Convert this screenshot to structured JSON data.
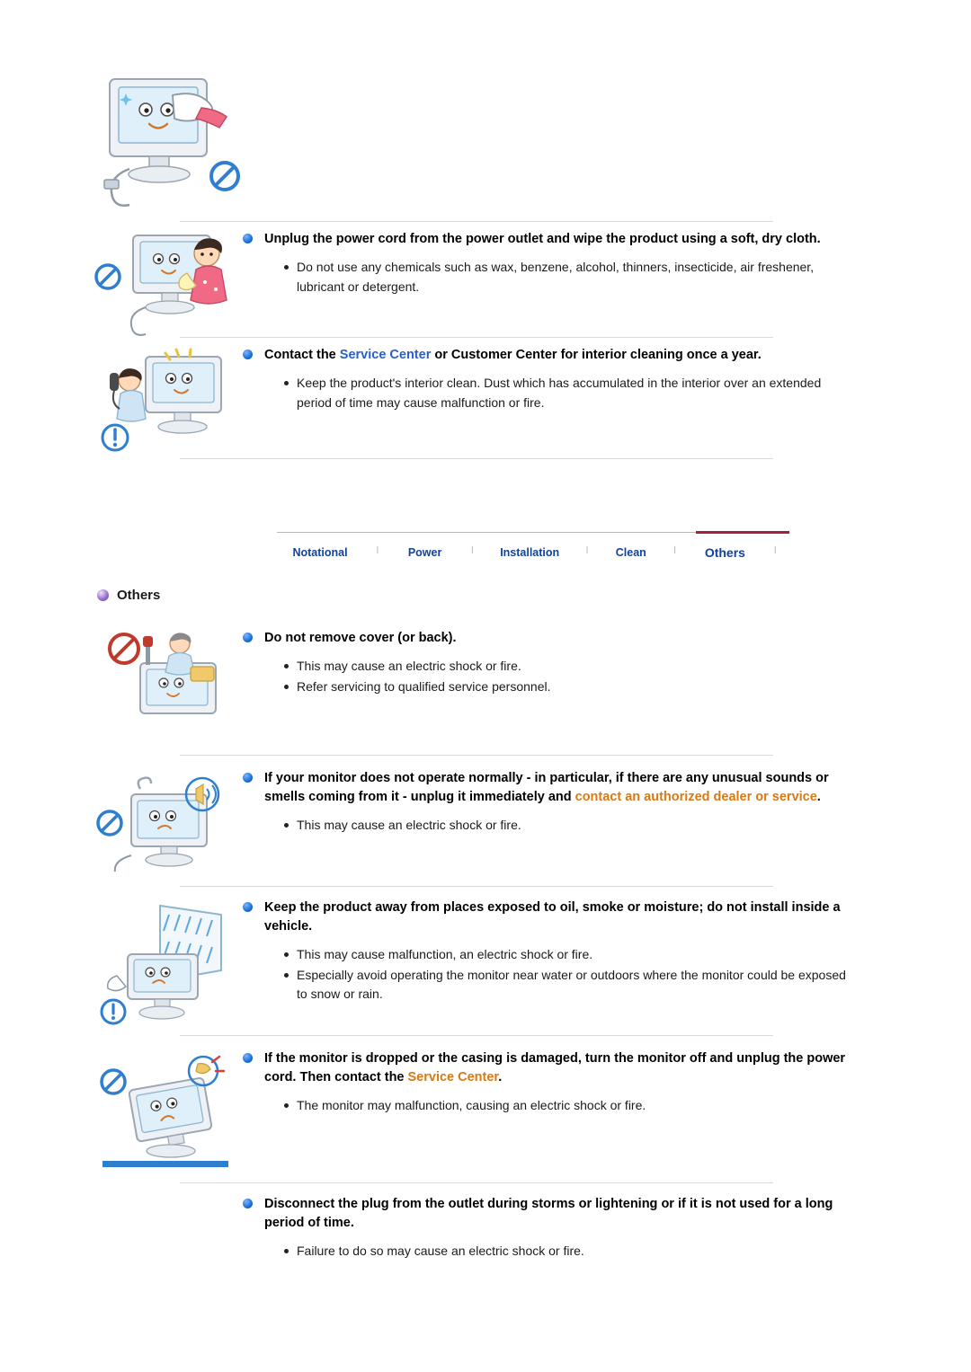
{
  "sections": {
    "top_illustration": {
      "name": "monitor-cleaning-cloth-illustration"
    },
    "unplug": {
      "heading_parts": [
        {
          "text": "Unplug the power cord from the power outlet and wipe the product using a soft, dry cloth.",
          "style": "normal"
        }
      ],
      "items": [
        "Do not use any chemicals such as wax, benzene, alcohol, thinners, insecticide, air freshener, lubricant or detergent."
      ]
    },
    "contact_center": {
      "heading_parts": [
        {
          "text": "Contact the ",
          "style": "normal"
        },
        {
          "text": "Service Center",
          "style": "blue"
        },
        {
          "text": " or Customer Center for interior cleaning once a year.",
          "style": "normal"
        }
      ],
      "items": [
        "Keep the product's interior clean. Dust which has accumulated in the interior over an extended period of time may cause malfunction or fire."
      ]
    }
  },
  "tabbar": {
    "tabs": [
      {
        "label": "Notational",
        "active": false
      },
      {
        "label": "Power",
        "active": false
      },
      {
        "label": "Installation",
        "active": false
      },
      {
        "label": "Clean",
        "active": false
      },
      {
        "label": "Others",
        "active": true
      }
    ],
    "separator": "l"
  },
  "others": {
    "title": "Others",
    "blocks": [
      {
        "id": "do-not-remove-cover",
        "heading_parts": [
          {
            "text": "Do not remove cover (or back).",
            "style": "normal"
          }
        ],
        "items": [
          "This may cause an electric shock or fire.",
          "Refer servicing to qualified service personnel."
        ]
      },
      {
        "id": "abnormal-operation",
        "heading_parts": [
          {
            "text": "If your monitor does not operate normally - in particular, if there are any unusual sounds or smells coming from it - unplug it immediately and ",
            "style": "normal"
          },
          {
            "text": "contact an authorized dealer or service",
            "style": "orange"
          },
          {
            "text": ".",
            "style": "normal"
          }
        ],
        "items": [
          "This may cause an electric shock or fire."
        ]
      },
      {
        "id": "keep-away-oil-smoke-moisture",
        "heading_parts": [
          {
            "text": "Keep the product away from places exposed to oil, smoke or moisture; do not install inside a vehicle.",
            "style": "normal"
          }
        ],
        "items": [
          "This may cause malfunction, an electric shock or fire.",
          "Especially avoid operating the monitor near water or outdoors where the monitor could be exposed to snow or rain."
        ]
      },
      {
        "id": "dropped-or-damaged",
        "heading_parts": [
          {
            "text": "If the monitor is dropped or the casing is damaged, turn the monitor off and unplug the power cord. Then contact the ",
            "style": "normal"
          },
          {
            "text": "Service Center",
            "style": "orange"
          },
          {
            "text": ".",
            "style": "normal"
          }
        ],
        "items": [
          "The monitor may malfunction, causing an electric shock or fire."
        ]
      },
      {
        "id": "storms-lightening",
        "heading_parts": [
          {
            "text": "Disconnect the plug from the outlet during storms or lightening or if it is not used for a long period of time.",
            "style": "normal"
          }
        ],
        "items": [
          "Failure to do so may cause an electric shock or fire."
        ]
      }
    ]
  },
  "colors": {
    "accent_blue": "#2a5fc7",
    "accent_orange": "#d77a12",
    "tab_text": "#13429b",
    "tab_underline": "#a4203c",
    "bullet_blue": "#1a6fd4",
    "bullet_purple": "#5b3a96"
  }
}
